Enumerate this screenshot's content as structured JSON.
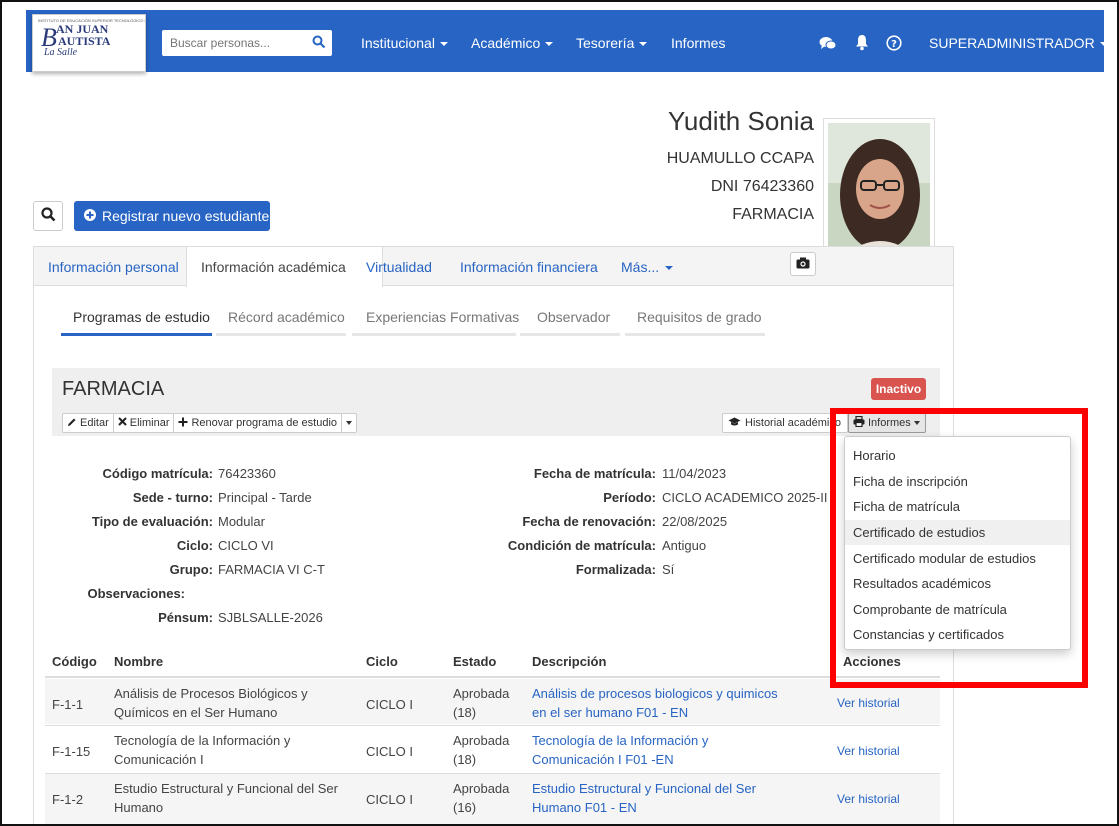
{
  "navbar": {
    "logo": {
      "tiny_line": "INSTITUTO DE EDUCACIÓN SUPERIOR TECNOLÓGICO PRIVADO",
      "line1": "AN JUAN",
      "line2": "AUTISTA",
      "line3": "La Salle"
    },
    "search_placeholder": "Buscar personas...",
    "menu": [
      "Institucional",
      "Académico",
      "Tesorería",
      "Informes"
    ],
    "user": "SUPERADMINISTRADOR",
    "bg_color": "#2764c3"
  },
  "profile": {
    "first_name": "Yudith Sonia",
    "last_name": "HUAMULLO CCAPA",
    "dni": "DNI 76423360",
    "program": "FARMACIA"
  },
  "actions": {
    "new_student": "Registrar nuevo estudiante"
  },
  "tabs": [
    "Información personal",
    "Información académica",
    "Virtualidad",
    "Información financiera",
    "Más..."
  ],
  "subtabs": [
    "Programas de estudio",
    "Récord académico",
    "Experiencias Formativas",
    "Observador",
    "Requisitos de grado"
  ],
  "program_box": {
    "title": "FARMACIA",
    "status": "Inactivo",
    "buttons": [
      "Editar",
      "Eliminar",
      "Renovar programa de estudio"
    ],
    "history_button": "Historial académico",
    "reports_button": "Informes"
  },
  "details_left": [
    {
      "label": "Código matrícula:",
      "value": "76423360"
    },
    {
      "label": "Sede - turno:",
      "value": "Principal - Tarde"
    },
    {
      "label": "Tipo de evaluación:",
      "value": "Modular"
    },
    {
      "label": "Ciclo:",
      "value": "CICLO VI"
    },
    {
      "label": "Grupo:",
      "value": "FARMACIA VI C-T"
    },
    {
      "label": "Observaciones:",
      "value": ""
    },
    {
      "label": "Pénsum:",
      "value": "SJBLSALLE-2026"
    }
  ],
  "details_right": [
    {
      "label": "Fecha de matrícula:",
      "value": "11/04/2023"
    },
    {
      "label": "Período:",
      "value": "CICLO ACADEMICO 2025-II"
    },
    {
      "label": "Fecha de renovación:",
      "value": "22/08/2025"
    },
    {
      "label": "Condición de matrícula:",
      "value": "Antiguo"
    },
    {
      "label": "Formalizada:",
      "value": "Sí"
    }
  ],
  "table": {
    "headers": [
      "Código",
      "Nombre",
      "Ciclo",
      "Estado",
      "Descripción",
      "Acciones"
    ],
    "rows": [
      {
        "code": "F-1-1",
        "name1": "Análisis de Procesos Biológicos y",
        "name2": "Químicos en el Ser Humano",
        "cycle": "CICLO I",
        "state1": "Aprobada",
        "state2": "(18)",
        "desc1": "Análisis de procesos biologicos y quimicos",
        "desc2": "en el ser humano F01 - EN",
        "action": "Ver historial"
      },
      {
        "code": "F-1-15",
        "name1": "Tecnología de la Información y",
        "name2": "Comunicación I",
        "cycle": "CICLO I",
        "state1": "Aprobada",
        "state2": "(18)",
        "desc1": "Tecnología de la Información y",
        "desc2": "Comunicación I F01 -EN",
        "action": "Ver historial"
      },
      {
        "code": "F-1-2",
        "name1": "Estudio Estructural y Funcional del Ser",
        "name2": "Humano",
        "cycle": "CICLO I",
        "state1": "Aprobada",
        "state2": "(16)",
        "desc1": "Estudio Estructural y Funcional del Ser",
        "desc2": "Humano F01 - EN",
        "action": "Ver historial"
      }
    ]
  },
  "reports_menu": {
    "items": [
      "Horario",
      "Ficha de inscripción",
      "Ficha de matrícula",
      "Certificado de estudios",
      "Certificado modular de estudios",
      "Resultados académicos",
      "Comprobante de matrícula",
      "Constancias y certificados"
    ],
    "highlighted": "Certificado de estudios"
  },
  "colors": {
    "primary": "#2764c3",
    "danger": "#d9534f",
    "annotation": "#ff0000"
  }
}
